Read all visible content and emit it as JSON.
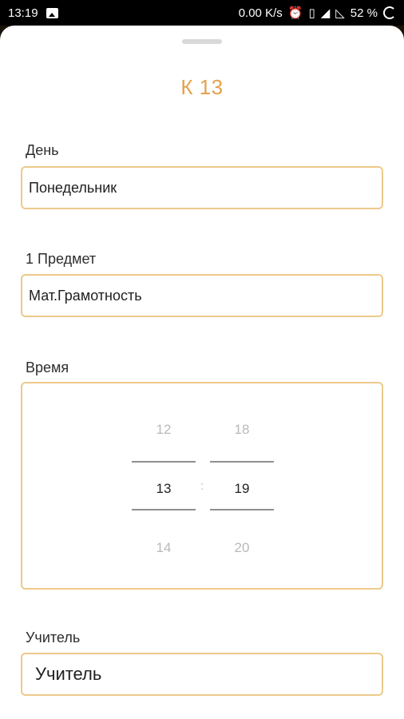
{
  "status_bar": {
    "time": "13:19",
    "net_speed": "0.00 K/s",
    "battery": "52 %"
  },
  "sheet": {
    "title": "К 13",
    "day": {
      "label": "День",
      "value": "Понедельник"
    },
    "subject": {
      "label": "1 Предмет",
      "value": "Мат.Грамотность"
    },
    "time": {
      "label": "Время",
      "hours": {
        "prev": "12",
        "selected": "13",
        "next": "14"
      },
      "minutes": {
        "prev": "18",
        "selected": "19",
        "next": "20"
      },
      "separator": ":"
    },
    "teacher": {
      "label": "Учитель",
      "value": "Учитель"
    }
  }
}
